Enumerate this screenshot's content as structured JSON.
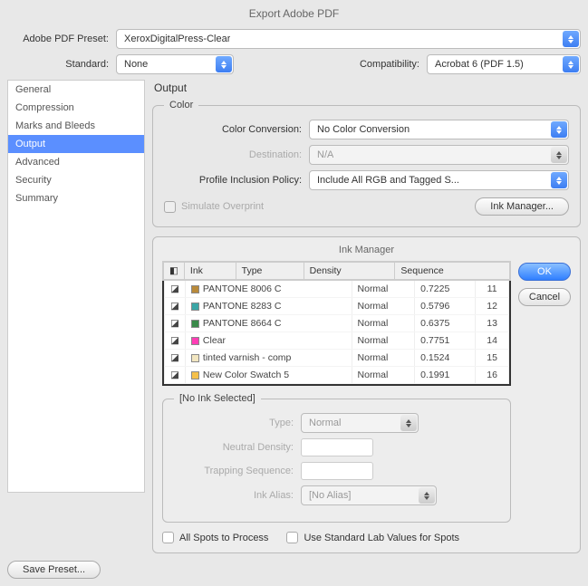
{
  "window_title": "Export Adobe PDF",
  "preset": {
    "label": "Adobe PDF Preset:",
    "value": "XeroxDigitalPress-Clear"
  },
  "standard": {
    "label": "Standard:",
    "value": "None"
  },
  "compatibility": {
    "label": "Compatibility:",
    "value": "Acrobat 6 (PDF 1.5)"
  },
  "sidebar": {
    "items": [
      "General",
      "Compression",
      "Marks and Bleeds",
      "Output",
      "Advanced",
      "Security",
      "Summary"
    ],
    "selected_index": 3
  },
  "content_title": "Output",
  "color_group": {
    "legend": "Color",
    "conversion": {
      "label": "Color Conversion:",
      "value": "No Color Conversion"
    },
    "destination": {
      "label": "Destination:",
      "value": "N/A"
    },
    "policy": {
      "label": "Profile Inclusion Policy:",
      "value": "Include All RGB and Tagged S..."
    },
    "simulate_overprint_label": "Simulate Overprint",
    "ink_manager_btn": "Ink Manager..."
  },
  "ink_dialog": {
    "title": "Ink Manager",
    "columns": [
      "Ink",
      "Type",
      "Density",
      "Sequence"
    ],
    "rows": [
      {
        "swatch": "#b98a3a",
        "name": "PANTONE 8006 C",
        "type": "Normal",
        "density": "0.7225",
        "seq": "11"
      },
      {
        "swatch": "#3aa6a6",
        "name": "PANTONE 8283 C",
        "type": "Normal",
        "density": "0.5796",
        "seq": "12"
      },
      {
        "swatch": "#3a8a4a",
        "name": "PANTONE 8664 C",
        "type": "Normal",
        "density": "0.6375",
        "seq": "13"
      },
      {
        "swatch": "#ff3db5",
        "name": "Clear",
        "type": "Normal",
        "density": "0.7751",
        "seq": "14"
      },
      {
        "swatch": "#f2e6c0",
        "name": "tinted varnish - comp",
        "type": "Normal",
        "density": "0.1524",
        "seq": "15"
      },
      {
        "swatch": "#f5c04a",
        "name": "New Color Swatch 5",
        "type": "Normal",
        "density": "0.1991",
        "seq": "16"
      }
    ],
    "no_ink_legend": "[No Ink Selected]",
    "type_label": "Type:",
    "type_value": "Normal",
    "nd_label": "Neutral Density:",
    "ts_label": "Trapping Sequence:",
    "alias_label": "Ink Alias:",
    "alias_value": "[No Alias]",
    "ok_btn": "OK",
    "cancel_btn": "Cancel",
    "all_spots_label": "All Spots to Process",
    "std_lab_label": "Use Standard Lab Values for Spots"
  },
  "save_preset_btn": "Save Preset..."
}
